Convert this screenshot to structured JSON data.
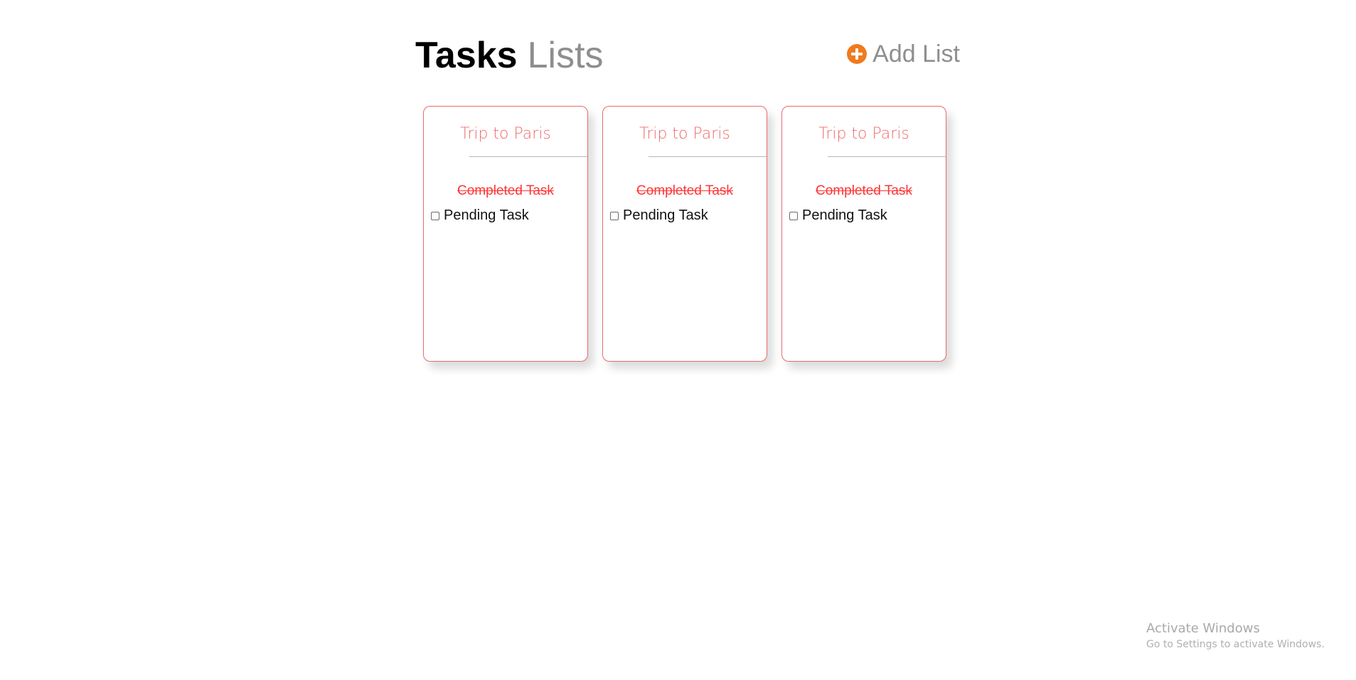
{
  "header": {
    "title_bold": "Tasks",
    "title_light": "Lists",
    "add_list_label": "Add List",
    "icons": {
      "add": "plus-circle-icon"
    },
    "colors": {
      "accent": "#f07a1f",
      "muted": "#8e8e8e",
      "primary_text": "#000000"
    }
  },
  "lists": [
    {
      "title": "Trip to Paris",
      "completed_task": "Completed Task",
      "pending_task": "Pending Task"
    },
    {
      "title": "Trip to Paris",
      "completed_task": "Completed Task",
      "pending_task": "Pending Task"
    },
    {
      "title": "Trip to Paris",
      "completed_task": "Completed Task",
      "pending_task": "Pending Task"
    }
  ],
  "watermark": {
    "title": "Activate Windows",
    "subtitle": "Go to Settings to activate Windows."
  },
  "colors": {
    "card_border": "#e86b6b",
    "card_title": "#ef6b6b",
    "completed_task": "#ff3535",
    "divider": "#b8b8b8"
  }
}
